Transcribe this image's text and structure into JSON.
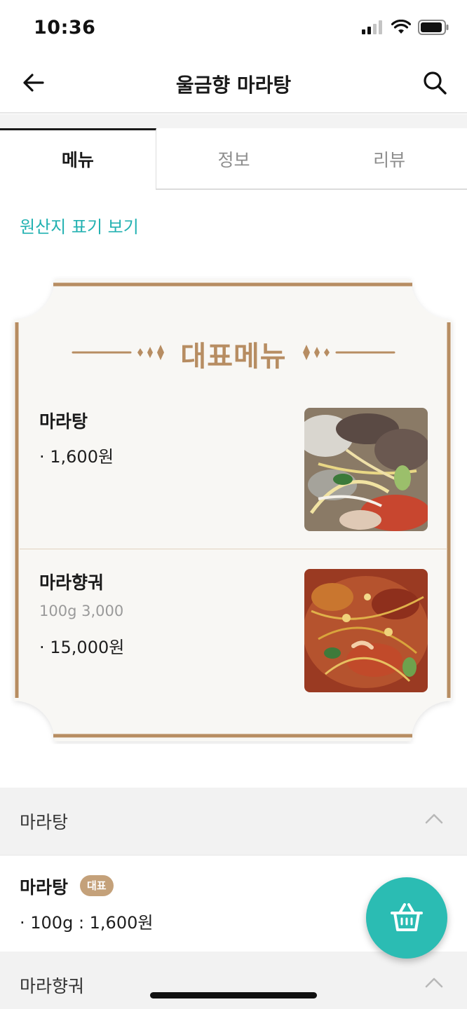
{
  "status": {
    "time": "10:36"
  },
  "nav": {
    "title": "울금향 마라탕",
    "back_icon": "arrow-left-icon",
    "search_icon": "search-icon"
  },
  "tabs": [
    {
      "label": "메뉴",
      "active": true
    },
    {
      "label": "정보",
      "active": false
    },
    {
      "label": "리뷰",
      "active": false
    }
  ],
  "origin_link": "원산지 표기 보기",
  "representative": {
    "title": "대표메뉴",
    "items": [
      {
        "name": "마라탕",
        "sub": "",
        "price": "1,600원"
      },
      {
        "name": "마라향궈",
        "sub": "100g 3,000",
        "price": "15,000원"
      }
    ]
  },
  "categories": [
    {
      "label": "마라탕",
      "items": [
        {
          "name": "마라탕",
          "badge": "대표",
          "price": "100g : 1,600원"
        }
      ]
    },
    {
      "label": "마라향궈",
      "items": []
    }
  ],
  "colors": {
    "accent": "#2bbcb3",
    "link": "#22b1b1",
    "frame_gold": "#b78d62",
    "badge": "#c4a17a"
  },
  "cart_icon": "basket-icon"
}
